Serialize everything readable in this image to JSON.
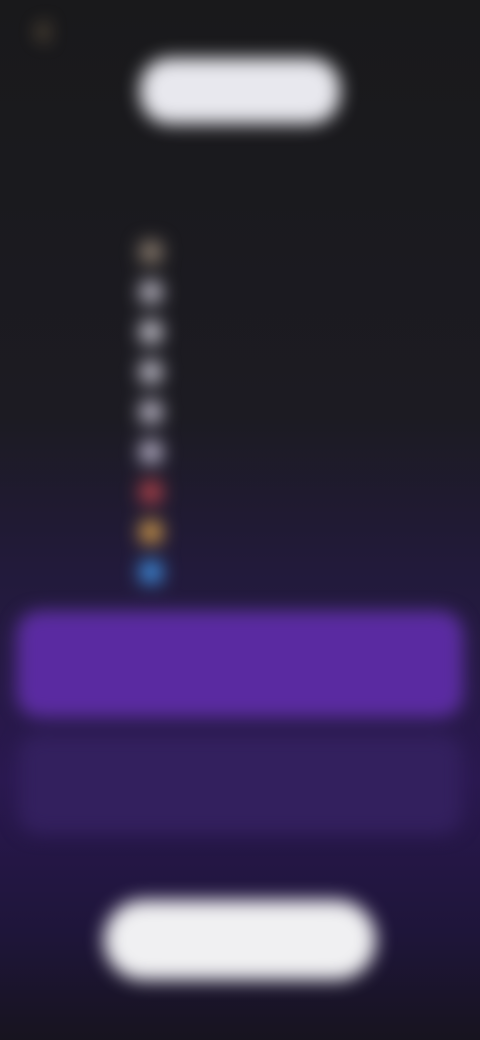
{
  "topbar": {
    "back_icon": "back-icon",
    "restore_label": ""
  },
  "hero": {
    "badge_text": ""
  },
  "subtitle": "",
  "features": [
    {
      "icon": "feature-icon",
      "color": "#8a7c6e",
      "label": ""
    },
    {
      "icon": "feature-icon",
      "color": "#b9b6c2",
      "label": ""
    },
    {
      "icon": "feature-icon",
      "color": "#c8c6d0",
      "label": ""
    },
    {
      "icon": "feature-icon",
      "color": "#c2c0cc",
      "label": ""
    },
    {
      "icon": "feature-icon",
      "color": "#bdb9c9",
      "label": ""
    },
    {
      "icon": "feature-icon",
      "color": "#b8b2c8",
      "label": ""
    },
    {
      "icon": "feature-icon",
      "color": "#b0434a",
      "label": ""
    },
    {
      "icon": "feature-icon",
      "color": "#d09a4a",
      "label": ""
    },
    {
      "icon": "feature-icon",
      "color": "#3f8fe0",
      "label": ""
    }
  ],
  "plans": {
    "yearly": {
      "name": "",
      "sub": "",
      "price": ""
    },
    "monthly": {
      "name": "",
      "sub": "",
      "price": ""
    }
  },
  "fineprint": "",
  "cta_label": ""
}
